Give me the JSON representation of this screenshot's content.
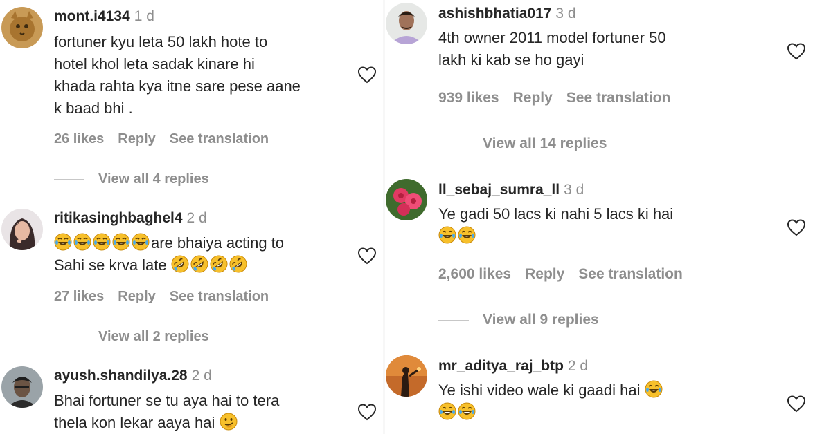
{
  "left_column": [
    {
      "username": "mont.i4134",
      "time": "1 d",
      "text_lines": [
        "fortuner kyu leta 50 lakh hote to",
        "hotel khol leta sadak kinare hi",
        "khada rahta kya itne sare pese aane",
        "k baad bhi ."
      ],
      "likes": "26 likes",
      "reply": "Reply",
      "translation": "See translation",
      "view_replies": "View all 4 replies"
    },
    {
      "username": "ritikasinghbaghel4",
      "time": "2 d",
      "text_line1": "are bhaiya acting to",
      "text_line2": "Sahi se krva late",
      "likes": "27 likes",
      "reply": "Reply",
      "translation": "See translation",
      "view_replies": "View all 2 replies"
    },
    {
      "username": "ayush.shandilya.28",
      "time": "2 d",
      "text_lines": [
        "Bhai fortuner se tu aya hai to tera",
        "thela kon lekar aaya hai"
      ]
    }
  ],
  "right_column": [
    {
      "username": "ashishbhatia017",
      "time": "3 d",
      "text_lines": [
        "4th owner 2011 model fortuner 50",
        "lakh ki kab se ho gayi"
      ],
      "likes": "939 likes",
      "reply": "Reply",
      "translation": "See translation",
      "view_replies": "View all 14 replies"
    },
    {
      "username": "ll_sebaj_sumra_ll",
      "time": "3 d",
      "text_line1": "Ye gadi 50 lacs ki nahi 5 lacs ki hai",
      "likes": "2,600 likes",
      "reply": "Reply",
      "translation": "See translation",
      "view_replies": "View all 9 replies"
    },
    {
      "username": "mr_aditya_raj_btp",
      "time": "2 d",
      "text_line1": "Ye ishi video wale ki gaadi hai"
    }
  ],
  "icons": {
    "like": "heart-outline-icon",
    "laugh": "tears-of-joy-emoji",
    "rofl": "rolling-on-floor-laughing-emoji",
    "smirk": "smirking-face-emoji"
  },
  "colors": {
    "text": "#262626",
    "muted": "#8e8e8e",
    "emoji": "#f7c02b"
  }
}
